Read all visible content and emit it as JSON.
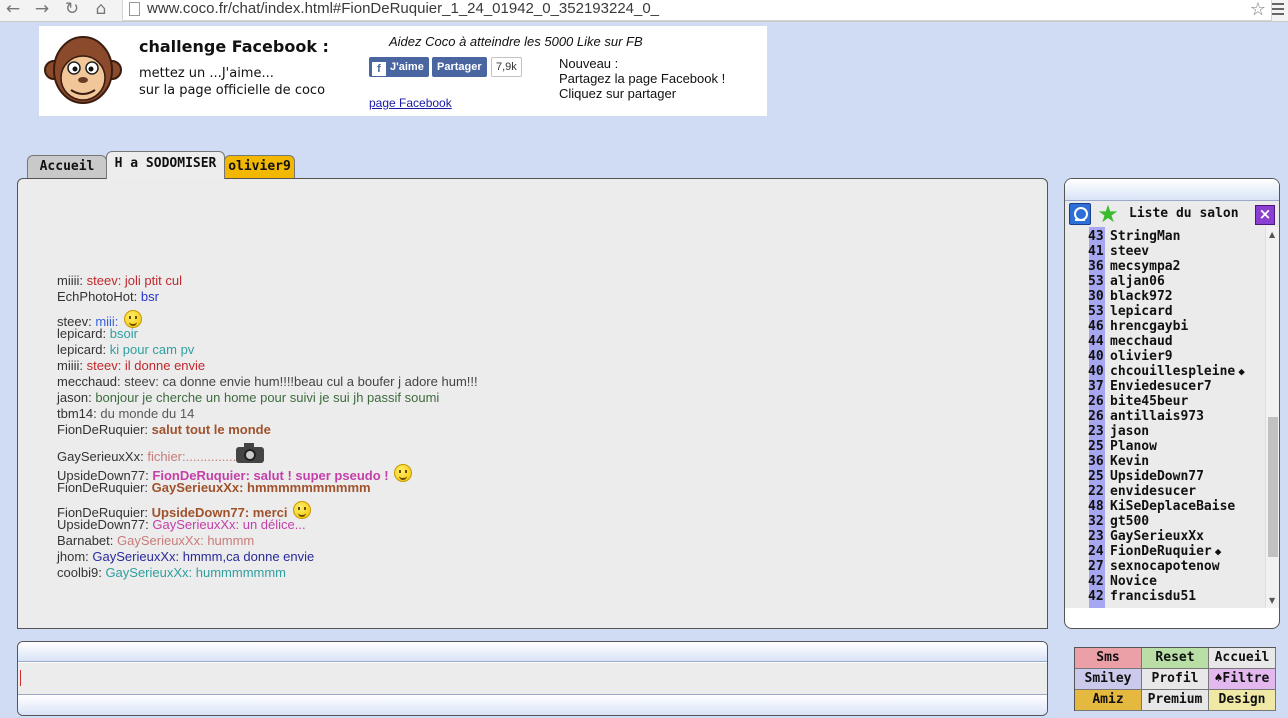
{
  "browser": {
    "url": "www.coco.fr/chat/index.html#FionDeRuquier_1_24_01942_0_352193224_0_",
    "icons": [
      "back-icon",
      "forward-icon",
      "reload-icon",
      "home-icon",
      "bookmark-star-icon",
      "menu-icon"
    ]
  },
  "banner": {
    "title": "challenge Facebook :",
    "line1": "mettez un ...J'aime...",
    "line2": "sur la page officielle de coco",
    "aidez": "Aidez Coco à atteindre les 5000 Like sur FB",
    "like_label": "J'aime",
    "share_label": "Partager",
    "like_count": "7,9k",
    "page_link": "page Facebook",
    "nouveau_1": "Nouveau :",
    "nouveau_2": "Partagez la page Facebook !",
    "nouveau_3": "Cliquez sur partager"
  },
  "tabs": [
    {
      "label": "Accueil"
    },
    {
      "label": "H a SODOMISER"
    },
    {
      "label": "olivier9"
    }
  ],
  "chat": {
    "messages": [
      {
        "user": "miiii:",
        "text": "steev: joli ptit cul",
        "color": "#c0282d",
        "bold": false,
        "extra": "",
        "tall": false
      },
      {
        "user": "EchPhotoHot:",
        "text": "bsr",
        "color": "#2a36c8",
        "bold": false,
        "extra": "",
        "tall": false
      },
      {
        "user": "steev:",
        "text": "miii:",
        "color": "#3a62d6",
        "bold": false,
        "extra": "smiley",
        "tall": true
      },
      {
        "user": "lepicard:",
        "text": "bsoir",
        "color": "#2f9f9f",
        "bold": false,
        "extra": "",
        "tall": false
      },
      {
        "user": "lepicard:",
        "text": "ki pour cam pv",
        "color": "#2f9f9f",
        "bold": false,
        "extra": "",
        "tall": false
      },
      {
        "user": "miiii:",
        "text": "steev: il donne envie",
        "color": "#c0282d",
        "bold": false,
        "extra": "",
        "tall": false
      },
      {
        "user": "mecchaud:",
        "text": "steev: ca donne envie hum!!!!beau cul a boufer j adore hum!!!",
        "color": "#444444",
        "bold": false,
        "extra": "",
        "tall": false
      },
      {
        "user": "jason:",
        "text": "bonjour je cherche un home pour suivi je sui jh passif soumi",
        "color": "#3e6b3e",
        "bold": false,
        "extra": "",
        "tall": false
      },
      {
        "user": "tbm14:",
        "text": "du monde du 14",
        "color": "#5a5a5a",
        "bold": false,
        "extra": "",
        "tall": false
      },
      {
        "user": "FionDeRuquier:",
        "text": "salut tout le monde",
        "color": "#a0522d",
        "bold": true,
        "extra": "",
        "tall": false
      },
      {
        "user": "GaySerieuxXx:",
        "text": "fichier:..............",
        "color": "#c87b7b",
        "bold": false,
        "extra": "camera",
        "tall": true
      },
      {
        "user": "UpsideDown77:",
        "text": "FionDeRuquier: salut ! super pseudo !",
        "color": "#c43fa8",
        "bold": true,
        "extra": "wink",
        "tall": true
      },
      {
        "user": "FionDeRuquier:",
        "text": "GaySerieuxXx: hmmmmmmmmmm",
        "color": "#a0522d",
        "bold": true,
        "extra": "",
        "tall": false
      },
      {
        "user": "FionDeRuquier:",
        "text": "UpsideDown77: merci",
        "color": "#a0522d",
        "bold": true,
        "extra": "smiley",
        "tall": true
      },
      {
        "user": "UpsideDown77:",
        "text": "GaySerieuxXx: un délice...",
        "color": "#c43fa8",
        "bold": false,
        "extra": "",
        "tall": false
      },
      {
        "user": "Barnabet:",
        "text": "GaySerieuxXx: hummm",
        "color": "#c87b7b",
        "bold": false,
        "extra": "",
        "tall": false
      },
      {
        "user": "jhom:",
        "text": "GaySerieuxXx: hmmm,ca donne envie",
        "color": "#2a2a9a",
        "bold": false,
        "extra": "",
        "tall": false
      },
      {
        "user": "coolbi9:",
        "text": "GaySerieuxXx: hummmmmmm",
        "color": "#2f9f9f",
        "bold": false,
        "extra": "",
        "tall": false
      }
    ]
  },
  "userlist": {
    "title": "Liste du salon",
    "users": [
      {
        "age": "43",
        "name": "StringMan",
        "mark": ""
      },
      {
        "age": "41",
        "name": "steev",
        "mark": ""
      },
      {
        "age": "36",
        "name": "mecsympa2",
        "mark": ""
      },
      {
        "age": "53",
        "name": "aljan06",
        "mark": ""
      },
      {
        "age": "30",
        "name": "black972",
        "mark": ""
      },
      {
        "age": "53",
        "name": "lepicard",
        "mark": ""
      },
      {
        "age": "46",
        "name": "hrencgaybi",
        "mark": ""
      },
      {
        "age": "44",
        "name": "mecchaud",
        "mark": ""
      },
      {
        "age": "40",
        "name": "olivier9",
        "mark": ""
      },
      {
        "age": "40",
        "name": "chcouillespleine",
        "mark": "◆"
      },
      {
        "age": "37",
        "name": "Enviedesucer7",
        "mark": ""
      },
      {
        "age": "26",
        "name": "bite45beur",
        "mark": ""
      },
      {
        "age": "26",
        "name": "antillais973",
        "mark": ""
      },
      {
        "age": "23",
        "name": "jason",
        "mark": ""
      },
      {
        "age": "25",
        "name": "Planow",
        "mark": ""
      },
      {
        "age": "36",
        "name": "Kevin",
        "mark": ""
      },
      {
        "age": "25",
        "name": "UpsideDown77",
        "mark": ""
      },
      {
        "age": "22",
        "name": "envidesucer",
        "mark": ""
      },
      {
        "age": "48",
        "name": "KiSeDeplaceBaise",
        "mark": ""
      },
      {
        "age": "32",
        "name": "gt500",
        "mark": ""
      },
      {
        "age": "23",
        "name": "GaySerieuxXx",
        "mark": ""
      },
      {
        "age": "24",
        "name": "FionDeRuquier",
        "mark": "◆"
      },
      {
        "age": "27",
        "name": "sexnocapotenow",
        "mark": ""
      },
      {
        "age": "42",
        "name": "Novice",
        "mark": ""
      },
      {
        "age": "42",
        "name": "francisdu51",
        "mark": ""
      }
    ]
  },
  "buttons": [
    {
      "label": "Sms",
      "bg": "#eba0a8"
    },
    {
      "label": "Reset",
      "bg": "#b9dfa7"
    },
    {
      "label": "Accueil",
      "bg": "#e8e8e8"
    },
    {
      "label": "Smiley",
      "bg": "#cbc9ec"
    },
    {
      "label": "Profil",
      "bg": "#e8e8e8"
    },
    {
      "label": "♠Filtre",
      "bg": "#e3b8ee"
    },
    {
      "label": "Amiz",
      "bg": "#e5b840"
    },
    {
      "label": "Premium",
      "bg": "#e8e8e8"
    },
    {
      "label": "Design",
      "bg": "#f0e9a5"
    }
  ]
}
